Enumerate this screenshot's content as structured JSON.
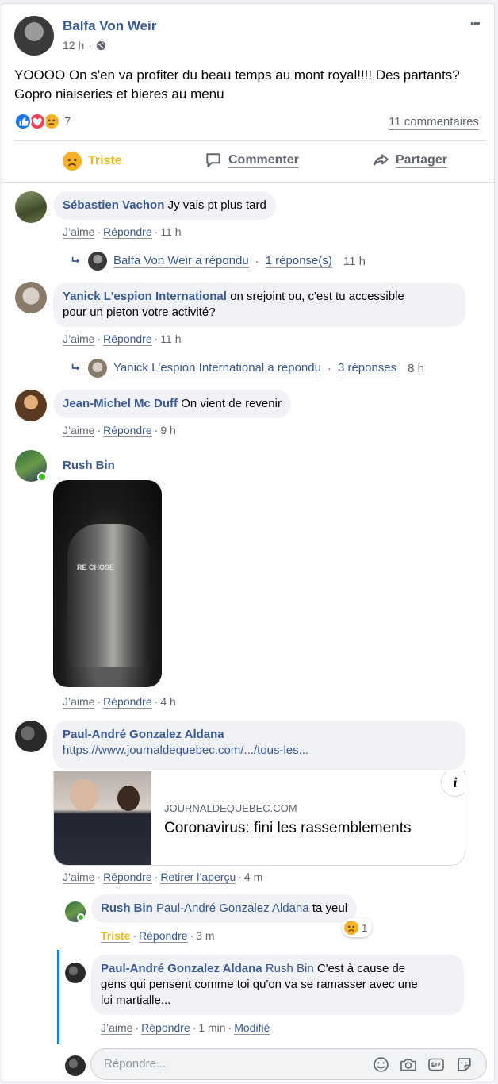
{
  "post": {
    "author": "Balfa Von Weir",
    "time": "12 h",
    "text_line1": "YOOOO On s'en va profiter du beau temps au mont royal!!!! Des partants?",
    "text_line2": "Gopro niaiseries et bieres au menu",
    "reaction_count": "7",
    "comments_link": "11 commentaires",
    "more_label": "•••"
  },
  "action_bar": {
    "reaction": "Triste",
    "comment": "Commenter",
    "share": "Partager"
  },
  "common": {
    "like": "J’aime",
    "reply": "Répondre",
    "sep": "·"
  },
  "comments": [
    {
      "author": "Sébastien Vachon",
      "text": "Jy vais pt plus tard",
      "time": "11 h",
      "reply_author": "Balfa Von Weir a répondu",
      "reply_count": "1 réponse(s)",
      "reply_time": "11 h"
    },
    {
      "author": "Yanick L'espion International",
      "text_line1": "on srejoint ou, c'est tu accessible",
      "text_line2": "pour un pieton votre activité?",
      "time": "11 h",
      "reply_author": "Yanick L'espion International a répondu",
      "reply_count": "3 réponses",
      "reply_time": "8 h"
    },
    {
      "author": "Jean-Michel Mc Duff",
      "text": "On vient de revenir",
      "time": "9 h"
    },
    {
      "author": "Rush Bin",
      "time": "4 h",
      "photo_text": "RE CHOSE"
    },
    {
      "author": "Paul-André Gonzalez Aldana",
      "url": "https://www.journaldequebec.com/.../tous-les...",
      "preview_domain": "JOURNALDEQUEBEC.COM",
      "preview_title": "Coronavirus: fini les rassemblements",
      "remove_preview": "Retirer l’aperçu",
      "time": "4 m",
      "info": "i"
    }
  ],
  "replies": [
    {
      "author": "Rush Bin",
      "mention": "Paul-André Gonzalez Aldana",
      "text": "ta yeul",
      "reaction_label": "Triste",
      "time": "3 m",
      "react_count": "1"
    },
    {
      "author": "Paul-André Gonzalez Aldana",
      "mention": "Rush Bin",
      "text_line1": "C'est à cause de",
      "text_line2": "gens qui pensent comme toi qu'on va se ramasser avec une",
      "text_line3": "loi martialle...",
      "time": "1 min",
      "modified": "Modifié"
    }
  ],
  "composer": {
    "placeholder": "Répondre..."
  },
  "colors": {
    "link": "#385898",
    "sad": "#f0ba15",
    "online": "#42b72a",
    "accent_line": "#1877f2"
  },
  "icons": [
    "globe-icon",
    "like-reaction-icon",
    "love-reaction-icon",
    "sad-reaction-icon",
    "comment-icon",
    "share-icon",
    "reply-arrow-icon",
    "emoji-icon",
    "camera-icon",
    "gif-icon",
    "sticker-icon",
    "info-icon",
    "more-icon"
  ]
}
